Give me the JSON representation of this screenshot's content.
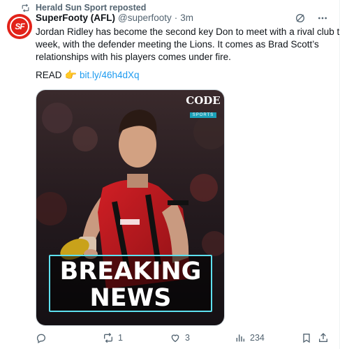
{
  "repost": {
    "text": "Herald Sun Sport reposted"
  },
  "author": {
    "avatar_text": "SF",
    "name": "SuperFooty (AFL)",
    "handle": "@superfooty",
    "separator": "·",
    "time": "3m"
  },
  "body": {
    "line1": "Jordan Ridley has become the second key Don to meet with a rival club this",
    "line2": "week, with the defender meeting the Lions. It comes as Brad Scott’s",
    "line3": "relationships with his players comes under fire.",
    "read_label": "READ",
    "read_emoji": "👉",
    "link": "bit.ly/46h4dXq"
  },
  "media": {
    "logo_big": "CODE",
    "logo_small": "SPORTS",
    "headline_line1": "BREAKING",
    "headline_line2": "NEWS"
  },
  "actions": {
    "reply_count": "",
    "repost_count": "1",
    "like_count": "3",
    "views_count": "234"
  },
  "colors": {
    "accent": "#1d9bf0",
    "muted": "#536471",
    "brand_red": "#e2231a",
    "breaking_border": "#5ee1f0"
  },
  "icons": {
    "repost": "repost-icon",
    "grok": "grok-icon",
    "more": "more-icon",
    "reply": "reply-icon",
    "like": "like-icon",
    "views": "views-icon",
    "bookmark": "bookmark-icon",
    "share": "share-icon"
  }
}
